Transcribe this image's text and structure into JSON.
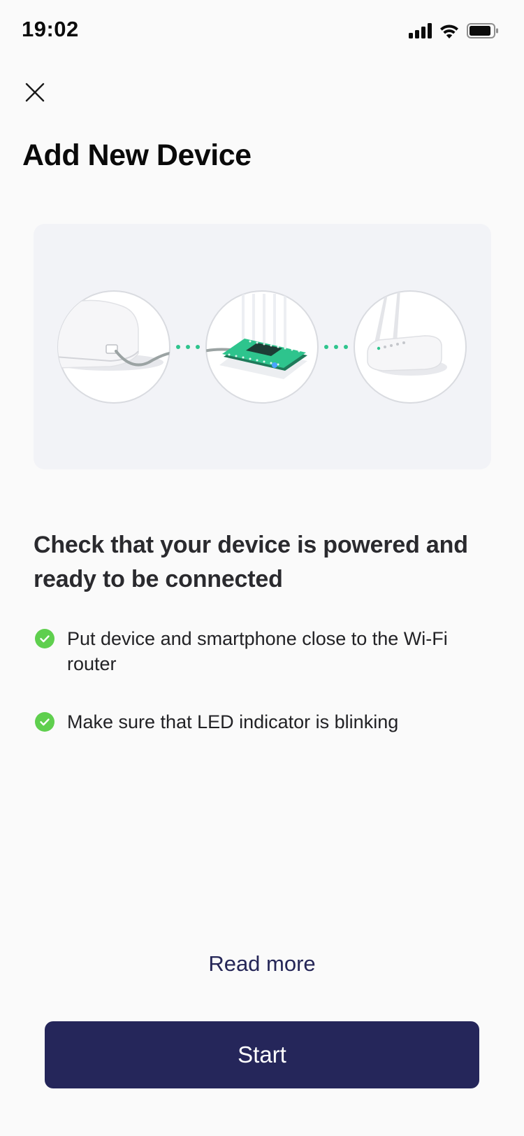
{
  "status_bar": {
    "time": "19:02",
    "icons": [
      "cellular-signal-icon",
      "wifi-icon",
      "battery-icon"
    ]
  },
  "header": {
    "close_icon": "close-icon",
    "title": "Add New Device"
  },
  "illustration": {
    "steps": [
      "device-power-cable-icon",
      "circuit-board-icon",
      "wifi-router-icon"
    ],
    "connector_color": "#2ec48d",
    "board_color": "#2ec48d"
  },
  "content": {
    "heading": "Check that your device is powered and ready to be connected",
    "checklist": [
      {
        "text": "Put device and smartphone close to the Wi-Fi router",
        "icon": "check-circle-icon"
      },
      {
        "text": "Make sure that LED indicator is blinking",
        "icon": "check-circle-icon"
      }
    ]
  },
  "actions": {
    "read_more": "Read more",
    "start": "Start"
  },
  "colors": {
    "accent": "#25265a",
    "check": "#5fcf4e",
    "background": "#fafafa",
    "card": "#f2f3f7"
  }
}
